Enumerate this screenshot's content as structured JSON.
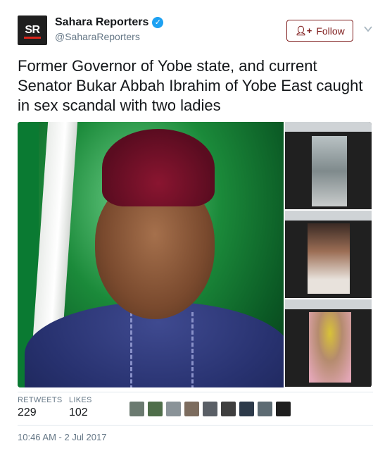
{
  "account": {
    "avatar_text": "SR",
    "display_name": "Sahara Reporters",
    "handle": "@SaharaReporters",
    "verified_icon": "verified-badge-icon"
  },
  "follow_button": {
    "label": "Follow",
    "icon": "add-user-icon"
  },
  "menu": {
    "icon": "chevron-down-icon"
  },
  "tweet": {
    "text": "Former Governor of Yobe state, and current Senator Bukar Abbah Ibrahim of Yobe East caught in sex scandal with two ladies"
  },
  "stats": {
    "retweets_label": "RETWEETS",
    "retweets_count": "229",
    "likes_label": "LIKES",
    "likes_count": "102",
    "liker_avatar_count": 9
  },
  "timestamp": "10:46 AM - 2 Jul 2017",
  "colors": {
    "follow_accent": "#7f1d1d",
    "verified": "#1da1f2",
    "muted_text": "#657786",
    "divider": "#e1e8ed"
  }
}
